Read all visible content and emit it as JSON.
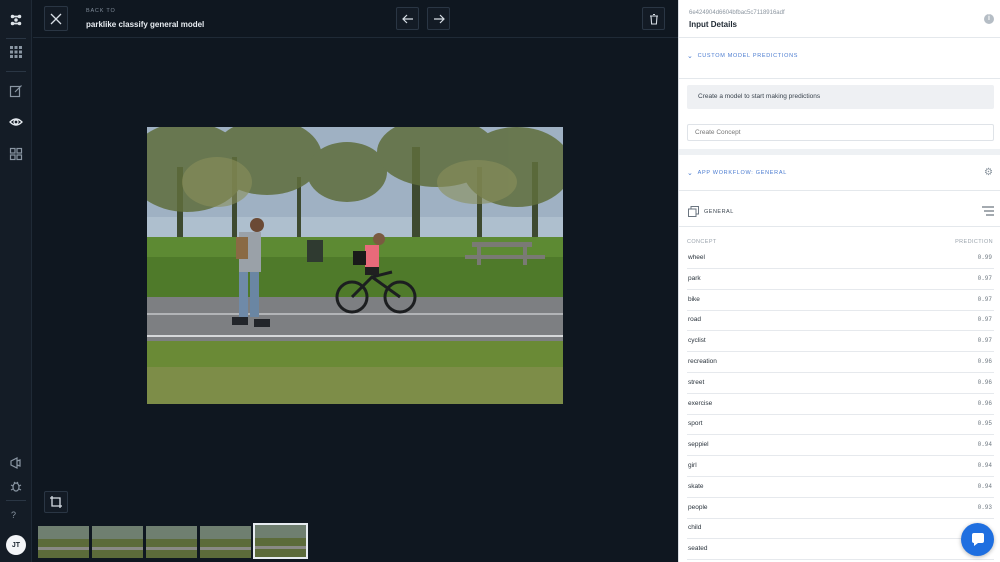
{
  "rail": {
    "logo": "clarifai-logo",
    "items": [
      "apps-grid-icon",
      "edit-icon",
      "eye-icon",
      "explorer-grid-icon"
    ],
    "bottom": [
      "megaphone-icon",
      "bug-icon"
    ],
    "help": "?",
    "avatar": "JT"
  },
  "viewer": {
    "back_label": "BACK TO",
    "model_name": "parklike classify general model",
    "thumbnails": 5,
    "selected_thumbnail": 5
  },
  "panel": {
    "input_id": "6e424904d6604bfbac5c7118916adf",
    "title": "Input Details",
    "custom_section": "CUSTOM MODEL PREDICTIONS",
    "notice": "Create a model to start making predictions",
    "create_placeholder": "Create Concept",
    "workflow_section": "APP WORKFLOW: GENERAL",
    "model_label": "GENERAL",
    "col_concept": "CONCEPT",
    "col_prediction": "PREDICTION",
    "predictions": [
      {
        "concept": "wheel",
        "value": "0.99"
      },
      {
        "concept": "park",
        "value": "0.97"
      },
      {
        "concept": "bike",
        "value": "0.97"
      },
      {
        "concept": "road",
        "value": "0.97"
      },
      {
        "concept": "cyclist",
        "value": "0.97"
      },
      {
        "concept": "recreation",
        "value": "0.96"
      },
      {
        "concept": "street",
        "value": "0.96"
      },
      {
        "concept": "exercise",
        "value": "0.96"
      },
      {
        "concept": "sport",
        "value": "0.95"
      },
      {
        "concept": "seppiel",
        "value": "0.94"
      },
      {
        "concept": "girl",
        "value": "0.94"
      },
      {
        "concept": "skate",
        "value": "0.94"
      },
      {
        "concept": "people",
        "value": "0.93"
      },
      {
        "concept": "child",
        "value": ""
      },
      {
        "concept": "seated",
        "value": ""
      }
    ]
  },
  "colors": {
    "accent": "#4a7bd0",
    "chat": "#1f6fe0",
    "dark_bg": "#0f1720"
  }
}
